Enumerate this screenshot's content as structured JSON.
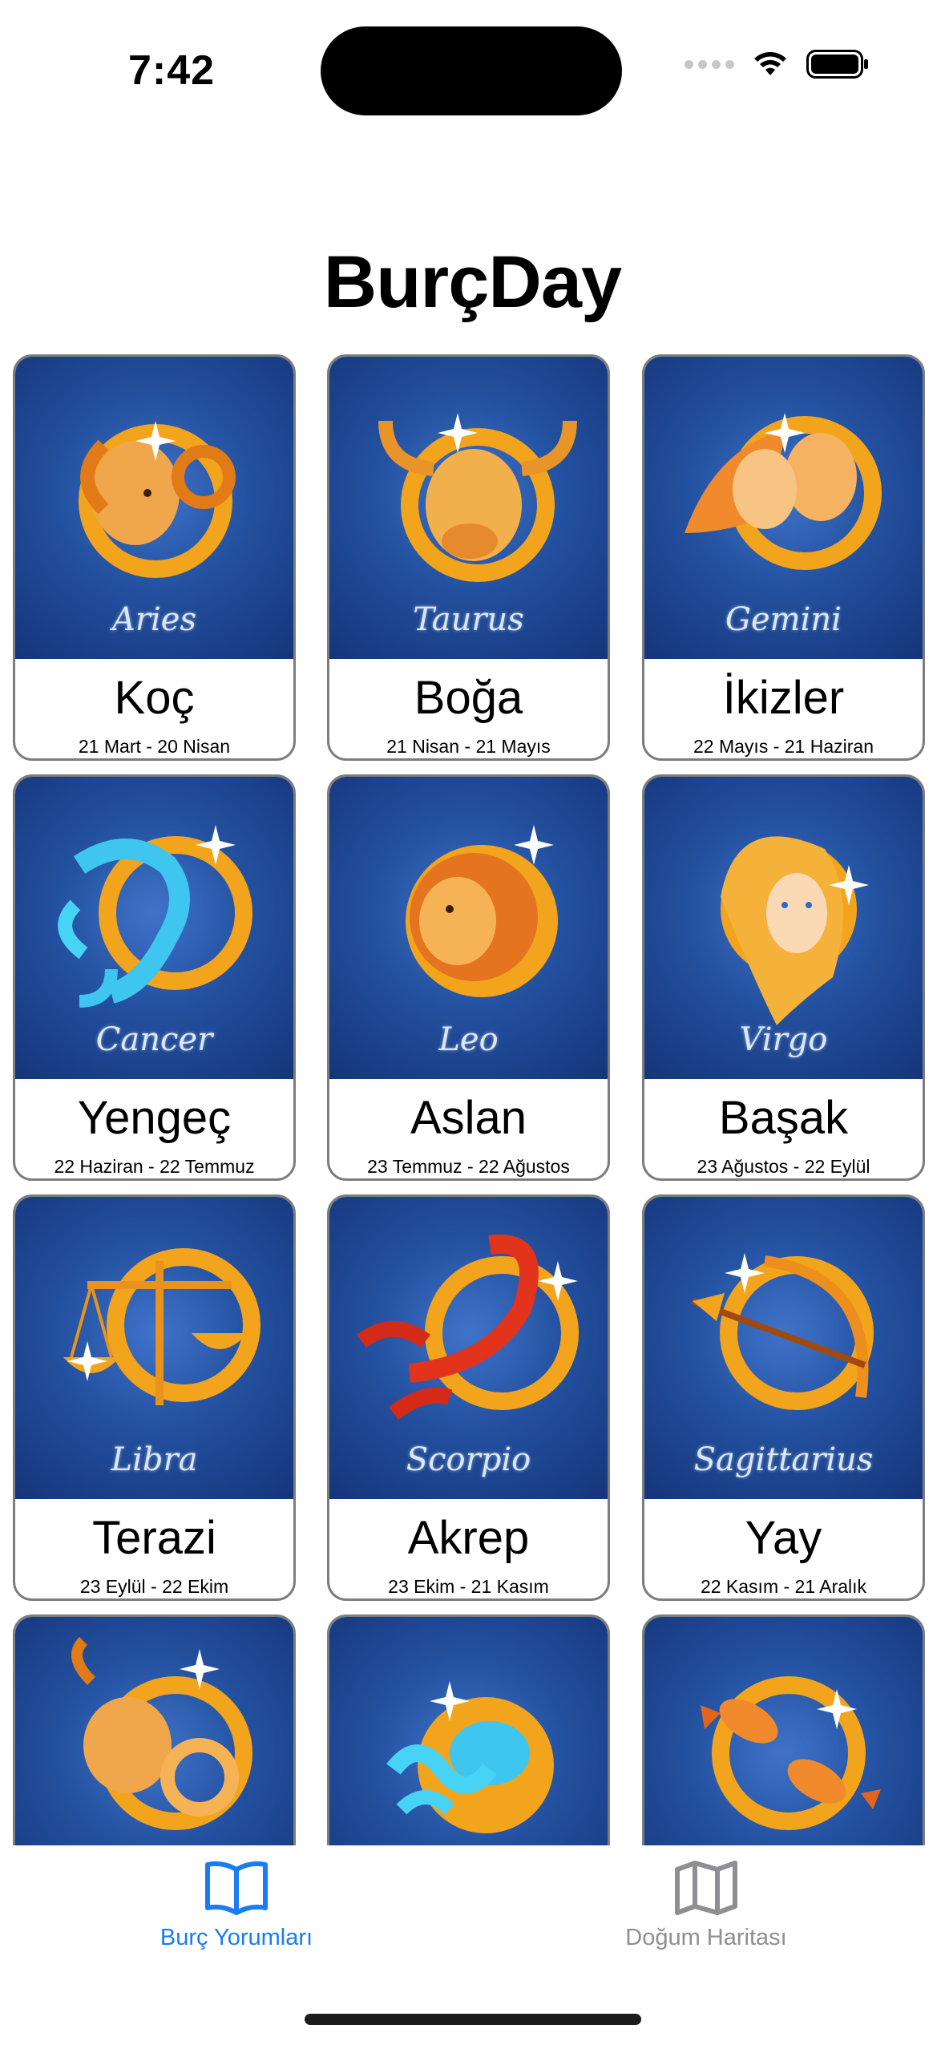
{
  "status_bar": {
    "time": "7:42"
  },
  "app": {
    "title": "BurçDay"
  },
  "signs": [
    {
      "latin": "Aries",
      "name": "Koç",
      "dates": "21 Mart - 20 Nisan",
      "icon": "ram-icon"
    },
    {
      "latin": "Taurus",
      "name": "Boğa",
      "dates": "21 Nisan - 21 Mayıs",
      "icon": "bull-icon"
    },
    {
      "latin": "Gemini",
      "name": "İkizler",
      "dates": "22 Mayıs - 21 Haziran",
      "icon": "twins-icon"
    },
    {
      "latin": "Cancer",
      "name": "Yengeç",
      "dates": "22 Haziran - 22 Temmuz",
      "icon": "crab-icon"
    },
    {
      "latin": "Leo",
      "name": "Aslan",
      "dates": "23 Temmuz - 22 Ağustos",
      "icon": "lion-icon"
    },
    {
      "latin": "Virgo",
      "name": "Başak",
      "dates": "23 Ağustos - 22 Eylül",
      "icon": "maiden-icon"
    },
    {
      "latin": "Libra",
      "name": "Terazi",
      "dates": "23 Eylül - 22 Ekim",
      "icon": "scales-icon"
    },
    {
      "latin": "Scorpio",
      "name": "Akrep",
      "dates": "23 Ekim - 21 Kasım",
      "icon": "scorpion-icon"
    },
    {
      "latin": "Sagittarius",
      "name": "Yay",
      "dates": "22 Kasım - 21 Aralık",
      "icon": "bow-icon"
    },
    {
      "latin": "",
      "name": "",
      "dates": "",
      "icon": "goat-icon"
    },
    {
      "latin": "",
      "name": "",
      "dates": "",
      "icon": "water-bearer-icon"
    },
    {
      "latin": "",
      "name": "",
      "dates": "",
      "icon": "fish-icon"
    }
  ],
  "tabs": [
    {
      "label": "Burç Yorumları",
      "icon": "book-icon",
      "active": true
    },
    {
      "label": "Doğum Haritası",
      "icon": "map-icon",
      "active": false
    }
  ],
  "colors": {
    "accent": "#1a7cf3",
    "inactive": "#8e8e93",
    "card_border": "#7d7d7d"
  }
}
